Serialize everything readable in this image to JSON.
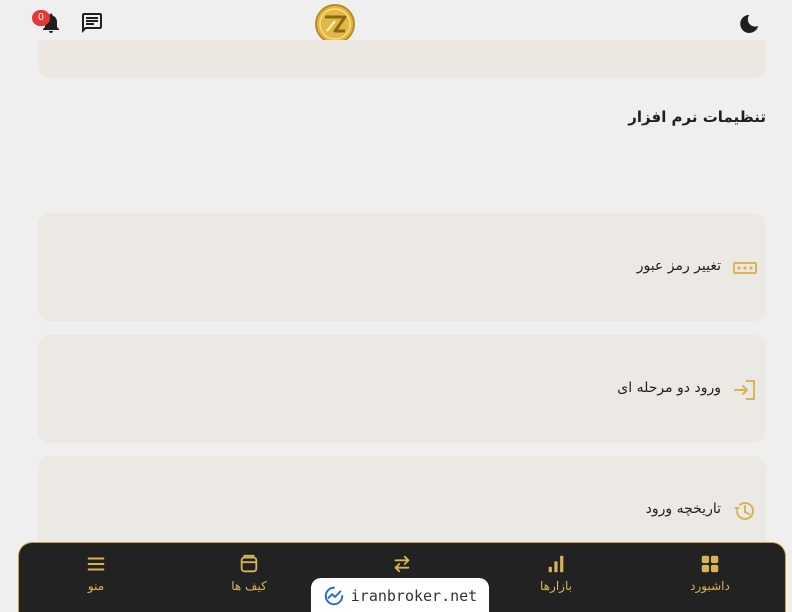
{
  "header": {
    "notifications_count": "0",
    "icons": [
      "bell-icon",
      "chat-icon",
      "logo",
      "moon-icon"
    ]
  },
  "settings": {
    "title": "تنظیمات نرم افزار",
    "items": [
      {
        "label": "تغییر رمز عبور",
        "icon": "password-icon"
      },
      {
        "label": "ورود دو مرحله ای",
        "icon": "login-icon"
      },
      {
        "label": "تاریخچه ورود",
        "icon": "history-icon"
      }
    ]
  },
  "nav": {
    "items": [
      {
        "label": "منو",
        "icon": "menu-icon"
      },
      {
        "label": "کیف ها",
        "icon": "wallet-icon"
      },
      {
        "label": "",
        "icon": "swap-icon"
      },
      {
        "label": "بازارها",
        "icon": "chart-icon"
      },
      {
        "label": "داشبورد",
        "icon": "dashboard-icon"
      }
    ]
  },
  "watermark": {
    "text": "iranbroker.net"
  },
  "colors": {
    "accent": "#d8b455",
    "background": "#efefef",
    "card": "#ece8e3",
    "nav_bg": "#222222",
    "badge": "#e53935"
  }
}
